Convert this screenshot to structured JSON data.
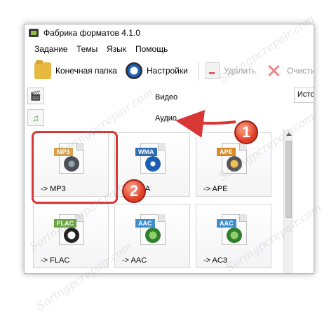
{
  "window": {
    "title": "Фабрика форматов 4.1.0"
  },
  "menu": {
    "items": [
      "Задание",
      "Темы",
      "Язык",
      "Помощь"
    ]
  },
  "toolbar": {
    "output_folder_label": "Конечная папка",
    "settings_label": "Настройки",
    "delete_label": "Удалить",
    "clear_label": "Очисти"
  },
  "categories": {
    "video": "Видео",
    "audio": "Аудио"
  },
  "right_panel": {
    "tab_label": "Исто"
  },
  "tiles": [
    {
      "label": "-> MP3",
      "tag": "MP3",
      "tag_color": "#d9a04a"
    },
    {
      "label": "-> WMA",
      "tag": "WMA",
      "tag_color": "#2e6db0"
    },
    {
      "label": "-> APE",
      "tag": "APE",
      "tag_color": "#d98b2b"
    },
    {
      "label": "-> FLAC",
      "tag": "FLAC",
      "tag_color": "#6aa63f"
    },
    {
      "label": "-> AAC",
      "tag": "AAC",
      "tag_color": "#3d8fd0"
    },
    {
      "label": "-> AC3",
      "tag": "AAC",
      "tag_color": "#3d8fd0"
    }
  ],
  "annotations": {
    "step1": "1",
    "step2": "2"
  },
  "watermark": "Soringpcrepair.com",
  "colors": {
    "highlight": "#d93636",
    "arrow": "#d93636"
  }
}
